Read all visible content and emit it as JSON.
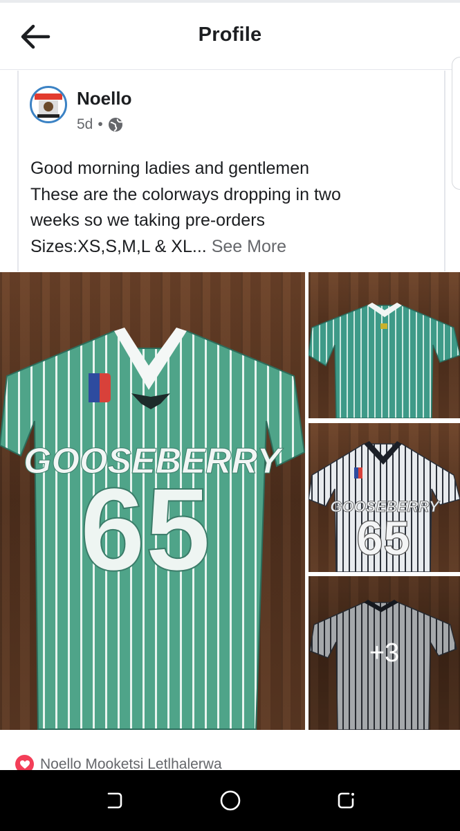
{
  "header": {
    "title": "Profile",
    "back_icon": "arrow-left-icon"
  },
  "post": {
    "author": "Noello",
    "time": "5d",
    "separator": "•",
    "privacy_icon": "globe-icon",
    "text_lines": [
      "Good morning ladies and gentlemen",
      "These are the colorways dropping in two",
      "weeks so we taking pre-orders",
      "Sizes:XS,S,M,L & XL..."
    ],
    "see_more": "See More",
    "photos": {
      "main": {
        "number": "65",
        "team": "GOOSEBERRY",
        "color": "#4fa489"
      },
      "thumb1": {
        "color": "#3e9a88"
      },
      "thumb2": {
        "number": "65",
        "team": "GOOSEBERRY",
        "color": "#e8ebee"
      },
      "thumb3": {
        "color": "#d4d8dc",
        "overlay": "+3"
      }
    },
    "reactions": {
      "icon": "heart-icon",
      "names": "Noello Mooketsi Letlhalerwa"
    }
  },
  "system_nav": {
    "recent": "recent-apps-icon",
    "home": "home-icon",
    "back": "back-icon"
  }
}
